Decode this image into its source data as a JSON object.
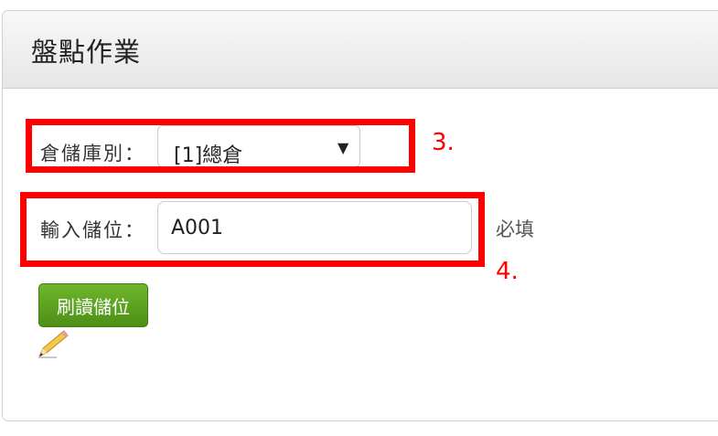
{
  "panel": {
    "title": "盤點作業"
  },
  "warehouse": {
    "label": "倉儲庫別：",
    "selected": "[1]總倉"
  },
  "location": {
    "label": "輸入儲位：",
    "value": "A001",
    "required_star": "*",
    "required_text": "必填"
  },
  "read_button": {
    "label": "刷讀儲位"
  },
  "annotations": {
    "step3": "3.",
    "step4": "4."
  },
  "colors": {
    "highlight": "#ff0000",
    "button": "#5aa11e"
  },
  "icons": {
    "edit": "pencil-icon",
    "dropdown": "triangle-down-icon"
  }
}
